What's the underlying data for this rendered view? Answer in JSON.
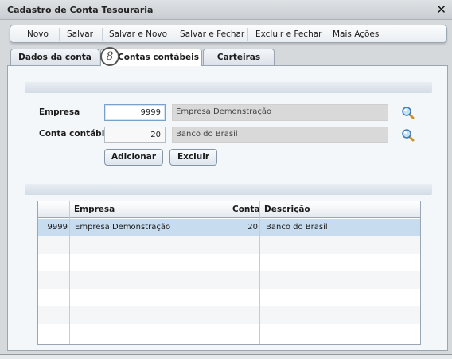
{
  "window": {
    "title": "Cadastro de Conta Tesouraria"
  },
  "background": {
    "glyphs": [
      "ri",
      "a",
      "C"
    ]
  },
  "toolbar": {
    "items": [
      "Novo",
      "Salvar",
      "Salvar e Novo",
      "Salvar e Fechar",
      "Excluir e Fechar",
      "Mais Ações"
    ]
  },
  "tabs": [
    {
      "label": "Dados da conta",
      "active": false
    },
    {
      "label": "Contas contábeis",
      "active": true
    },
    {
      "label": "Carteiras",
      "active": false
    }
  ],
  "tab_badge": "8",
  "form": {
    "empresa_label": "Empresa",
    "empresa_code": "9999",
    "empresa_desc": "Empresa Demonstração",
    "conta_label": "Conta contábil",
    "conta_code": "20",
    "conta_desc": "Banco do Brasil",
    "add_label": "Adicionar",
    "delete_label": "Excluir"
  },
  "grid": {
    "headers": [
      "Empresa",
      "Conta",
      "Descrição"
    ],
    "rows": [
      {
        "code": "9999",
        "empresa": "Empresa Demonstração",
        "conta": "20",
        "descricao": "Banco do Brasil",
        "selected": true
      }
    ]
  },
  "colors": {
    "selected_row": "#c8dcef",
    "panel": "#f4f7fa",
    "border": "#9aa6b2"
  }
}
